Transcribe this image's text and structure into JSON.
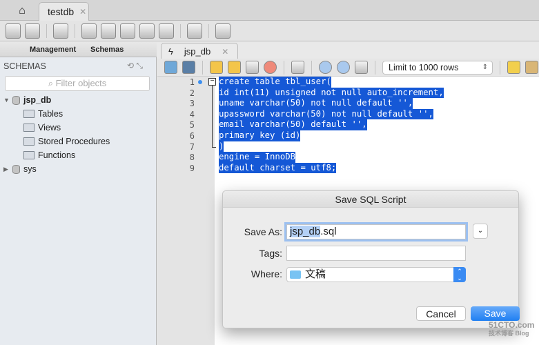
{
  "tabs": {
    "connection": "testdb"
  },
  "sidebar": {
    "tabs": [
      "Management",
      "Schemas"
    ],
    "header": "SCHEMAS",
    "filter_placeholder": "Filter objects",
    "tree": [
      {
        "label": "jsp_db"
      },
      {
        "label": "Tables"
      },
      {
        "label": "Views"
      },
      {
        "label": "Stored Procedures"
      },
      {
        "label": "Functions"
      },
      {
        "label": "sys"
      }
    ]
  },
  "editor": {
    "tab": "jsp_db",
    "limit": "Limit to 1000 rows",
    "lines": [
      "create table tbl_user(",
      "id int(11) unsigned not null auto_increment,",
      "uname varchar(50) not null default '',",
      "upassword varchar(50) not null default '',",
      "email varchar(50) default '',",
      "primary key (id)",
      ")",
      "engine = InnoDB",
      "default charset = utf8;"
    ],
    "line_numbers": [
      "1",
      "2",
      "3",
      "4",
      "5",
      "6",
      "7",
      "8",
      "9"
    ]
  },
  "dialog": {
    "title": "Save SQL Script",
    "save_as_label": "Save As:",
    "save_as_selected": "jsp_db",
    "save_as_rest": ".sql",
    "tags_label": "Tags:",
    "tags_value": "",
    "where_label": "Where:",
    "where_value": "文稿",
    "cancel": "Cancel",
    "save": "Save"
  },
  "watermark": {
    "line1": "51CTO.com",
    "line2": "技术博客 Blog"
  }
}
